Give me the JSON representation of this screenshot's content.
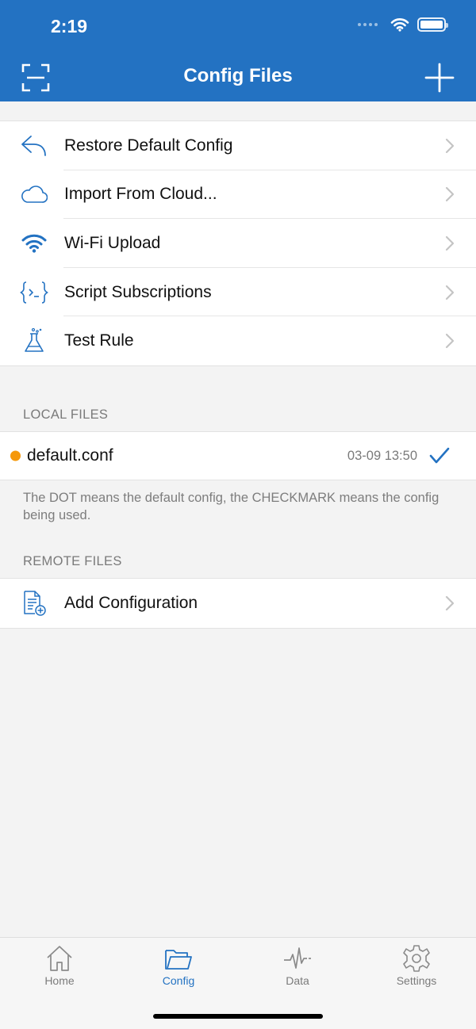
{
  "status": {
    "time": "2:19"
  },
  "nav": {
    "title": "Config Files",
    "left_icon": "scan-icon",
    "right_icon": "plus-icon"
  },
  "menu": [
    {
      "label": "Restore Default Config",
      "icon": "reply-arrow-icon"
    },
    {
      "label": "Import From Cloud...",
      "icon": "cloud-icon"
    },
    {
      "label": "Wi-Fi Upload",
      "icon": "wifi-icon"
    },
    {
      "label": "Script Subscriptions",
      "icon": "script-braces-icon"
    },
    {
      "label": "Test Rule",
      "icon": "flask-icon"
    }
  ],
  "local_files": {
    "header": "LOCAL FILES",
    "files": [
      {
        "name": "default.conf",
        "date": "03-09 13:50",
        "is_default": true,
        "in_use": true
      }
    ],
    "note": "The DOT means the default config, the CHECKMARK means the config being used."
  },
  "remote_files": {
    "header": "REMOTE FILES",
    "items": [
      {
        "label": "Add Configuration",
        "icon": "document-add-icon"
      }
    ]
  },
  "tabs": [
    {
      "label": "Home",
      "icon": "home-icon",
      "active": false
    },
    {
      "label": "Config",
      "icon": "folder-icon",
      "active": true
    },
    {
      "label": "Data",
      "icon": "pulse-icon",
      "active": false
    },
    {
      "label": "Settings",
      "icon": "gear-icon",
      "active": false
    }
  ],
  "colors": {
    "accent": "#2372c2",
    "dot": "#f5980b",
    "background": "#f3f3f3"
  }
}
